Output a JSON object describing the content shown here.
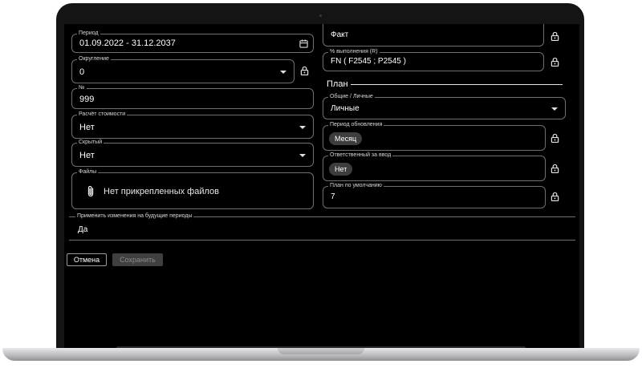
{
  "left": {
    "period": {
      "label": "Период",
      "value": "01.09.2022 - 31.12.2037"
    },
    "rounding": {
      "label": "Округление",
      "value": "0"
    },
    "number": {
      "label": "№",
      "value": "999"
    },
    "cost_calc": {
      "label": "Расчёт стоимости",
      "value": "Нет"
    },
    "hidden": {
      "label": "Скрытый",
      "value": "Нет"
    },
    "files": {
      "label": "Файлы",
      "value": "Нет прикрепленных файлов"
    }
  },
  "right": {
    "fact": {
      "value": "Факт"
    },
    "completion": {
      "label": "% выполнения (R)",
      "value": "FN ( F2545 ; P2545 )"
    },
    "plan_section": {
      "title": "План"
    },
    "general_personal": {
      "label": "Общие / Личные",
      "value": "Личные"
    },
    "update_period": {
      "label": "Период обновления",
      "value": "Месяц"
    },
    "responsible": {
      "label": "Ответственный за ввод",
      "value": "Нет"
    },
    "default_plan": {
      "label": "План по умолчанию",
      "value": "7"
    }
  },
  "apply_future": {
    "label": "Применить изменения на будущие периоды",
    "value": "Да"
  },
  "actions": {
    "cancel": "Отмена",
    "save": "Сохранить"
  },
  "colors": {
    "background": "#000000",
    "border": "#6f6f6f",
    "chip": "#3d3d3d",
    "disabled": "#3f3f3f"
  }
}
